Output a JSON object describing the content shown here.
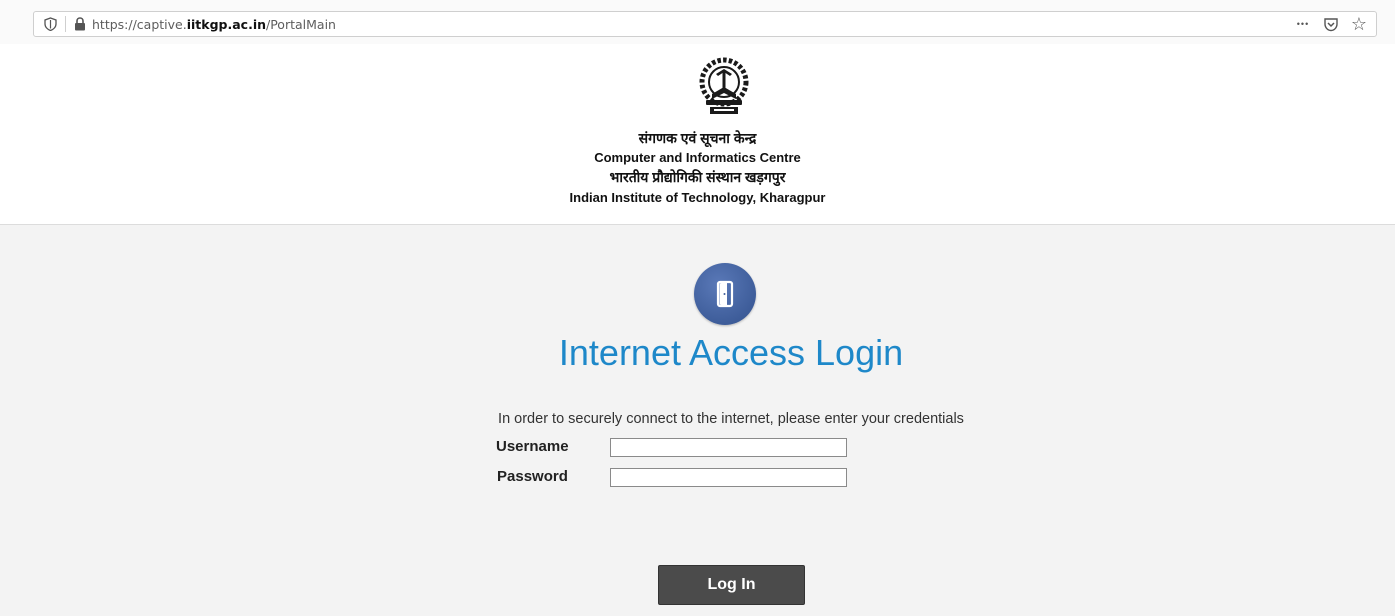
{
  "browser": {
    "url_prefix": "https://captive.",
    "url_host": "iitkgp.ac.in",
    "url_path": "/PortalMain",
    "icons": [
      "shield-icon",
      "lock-icon",
      "more-icon",
      "pocket-icon",
      "bookmark-star-icon"
    ],
    "more_glyph": "•••",
    "star_glyph": "☆"
  },
  "header": {
    "line1_hindi": "संगणक एवं सूचना केन्द्र",
    "line2": "Computer and Informatics Centre",
    "line3_hindi": "भारतीय प्रौद्योगिकी संस्थान खड़गपुर",
    "line4": "Indian Institute of Technology, Kharagpur"
  },
  "login": {
    "title": "Internet Access Login",
    "instructions": "In order to securely connect to the internet, please enter your credentials",
    "username_label": "Username",
    "password_label": "Password",
    "username_value": "",
    "password_value": "",
    "button_label": "Log In"
  },
  "colors": {
    "title": "#1e88c9",
    "button_bg": "#4b4b4b",
    "door_circle": "#3e5d9a",
    "page_bg": "#f3f3f3"
  }
}
